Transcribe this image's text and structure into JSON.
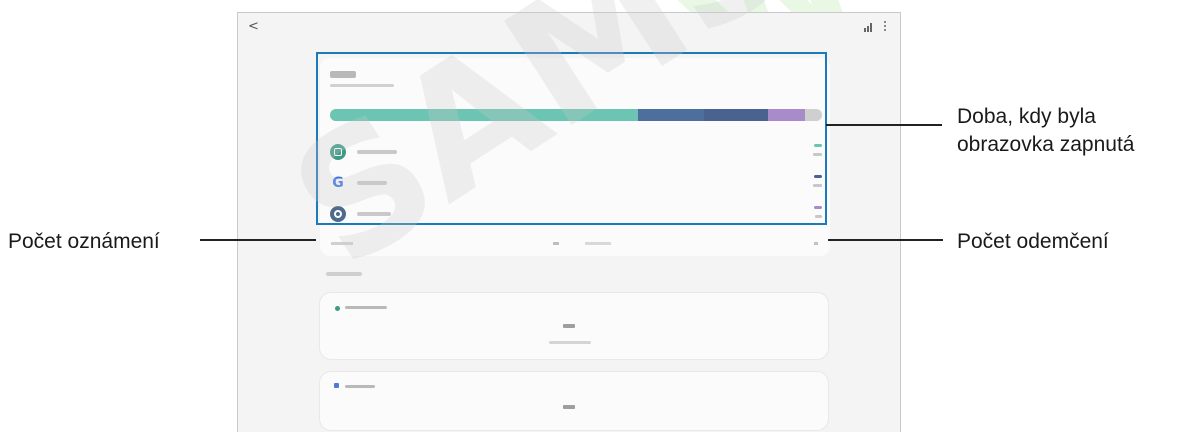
{
  "device": {
    "back_glyph": "<",
    "icons": [
      "stats-icon",
      "more-options-icon"
    ]
  },
  "usage_bar": {
    "segments": [
      {
        "name": "teal",
        "fraction": 0.625,
        "color": "#6cc5b3"
      },
      {
        "name": "dark-blue-1",
        "fraction": 0.135,
        "color": "#4e6e9e"
      },
      {
        "name": "dark-blue-2",
        "fraction": 0.13,
        "color": "#4a6290"
      },
      {
        "name": "purple",
        "fraction": 0.075,
        "color": "#a88bcb"
      },
      {
        "name": "grey",
        "fraction": 0.035,
        "color": "#cfcfcf"
      }
    ]
  },
  "apps": [
    {
      "icon": "calendar-icon",
      "pill_color": "#6cc5b3"
    },
    {
      "icon": "google-icon",
      "glyph": "G",
      "pill_color": "#4a6290"
    },
    {
      "icon": "settings-icon",
      "pill_color": "#a88bcb"
    }
  ],
  "callouts": {
    "screen_time": [
      "Doba, kdy byla",
      "obrazovka zapnutá"
    ],
    "notifications": "Počet oznámení",
    "unlocks": "Počet odemčení"
  },
  "colors": {
    "highlight_border": "#1b7ab8",
    "teal": "#3e9a86"
  },
  "watermark": {
    "grey": "SAMSUNG",
    "green": "RWW"
  }
}
